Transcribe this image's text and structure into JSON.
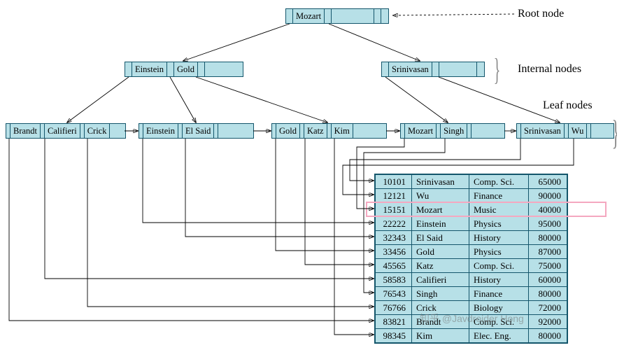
{
  "labels": {
    "root": "Root node",
    "internal": "Internal nodes",
    "leaf": "Leaf nodes"
  },
  "root": {
    "keys": [
      "Mozart"
    ]
  },
  "internal": [
    {
      "keys": [
        "Einstein",
        "Gold"
      ]
    },
    {
      "keys": [
        "Srinivasan"
      ]
    }
  ],
  "leaves": [
    {
      "keys": [
        "Brandt",
        "Califieri",
        "Crick"
      ]
    },
    {
      "keys": [
        "Einstein",
        "El Said"
      ]
    },
    {
      "keys": [
        "Gold",
        "Katz",
        "Kim"
      ]
    },
    {
      "keys": [
        "Mozart",
        "Singh"
      ]
    },
    {
      "keys": [
        "Srinivasan",
        "Wu"
      ]
    }
  ],
  "table": {
    "rows": [
      {
        "id": "10101",
        "name": "Srinivasan",
        "dept": "Comp. Sci.",
        "salary": "65000"
      },
      {
        "id": "12121",
        "name": "Wu",
        "dept": "Finance",
        "salary": "90000"
      },
      {
        "id": "15151",
        "name": "Mozart",
        "dept": "Music",
        "salary": "40000"
      },
      {
        "id": "22222",
        "name": "Einstein",
        "dept": "Physics",
        "salary": "95000"
      },
      {
        "id": "32343",
        "name": "El Said",
        "dept": "History",
        "salary": "80000"
      },
      {
        "id": "33456",
        "name": "Gold",
        "dept": "Physics",
        "salary": "87000"
      },
      {
        "id": "45565",
        "name": "Katz",
        "dept": "Comp. Sci.",
        "salary": "75000"
      },
      {
        "id": "58583",
        "name": "Califieri",
        "dept": "History",
        "salary": "60000"
      },
      {
        "id": "76543",
        "name": "Singh",
        "dept": "Finance",
        "salary": "80000"
      },
      {
        "id": "76766",
        "name": "Crick",
        "dept": "Biology",
        "salary": "72000"
      },
      {
        "id": "83821",
        "name": "Brandt",
        "dept": "Comp. Sci.",
        "salary": "92000"
      },
      {
        "id": "98345",
        "name": "Kim",
        "dept": "Elec. Eng.",
        "salary": "80000"
      }
    ],
    "highlight_row": 2
  },
  "watermark": "知乎 @Javdroider Hong"
}
